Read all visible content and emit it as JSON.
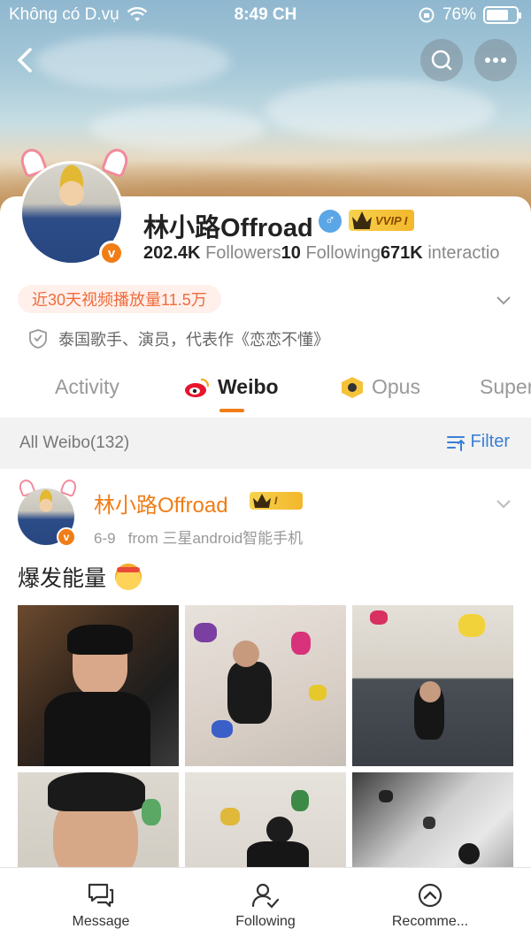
{
  "status_bar": {
    "carrier": "Không có D.vụ",
    "time": "8:49 CH",
    "battery": "76%",
    "battery_level": 0.76
  },
  "profile": {
    "name": "林小路Offroad",
    "vip_label": "VVIP I",
    "followers_count": "202.4K",
    "followers_label": "Followers",
    "following_count": "10",
    "following_label": "Following",
    "interactions_count": "671K",
    "interactions_label": "interactio",
    "promo": "近30天视频播放量11.5万",
    "intro": "泰国歌手、演员，代表作《恋恋不懂》",
    "verified_badge": "v"
  },
  "tabs": [
    {
      "label": "Activity"
    },
    {
      "label": "Weibo"
    },
    {
      "label": "Opus"
    },
    {
      "label": "Super"
    }
  ],
  "filter_bar": {
    "all_label": "All Weibo(132)",
    "filter_label": "Filter"
  },
  "post": {
    "author": "林小路Offroad",
    "vip_label": "I",
    "date": "6-9",
    "source": "from 三星android智能手机",
    "text": "爆发能量"
  },
  "bottom_bar": [
    {
      "label": "Message",
      "icon": "message-icon"
    },
    {
      "label": "Following",
      "icon": "follow-user-icon"
    },
    {
      "label": "Recomme...",
      "icon": "recommend-icon"
    }
  ],
  "colors": {
    "accent_orange": "#f07d16",
    "link_blue": "#3b7fd6",
    "vip_gold": "#f5c23a"
  }
}
